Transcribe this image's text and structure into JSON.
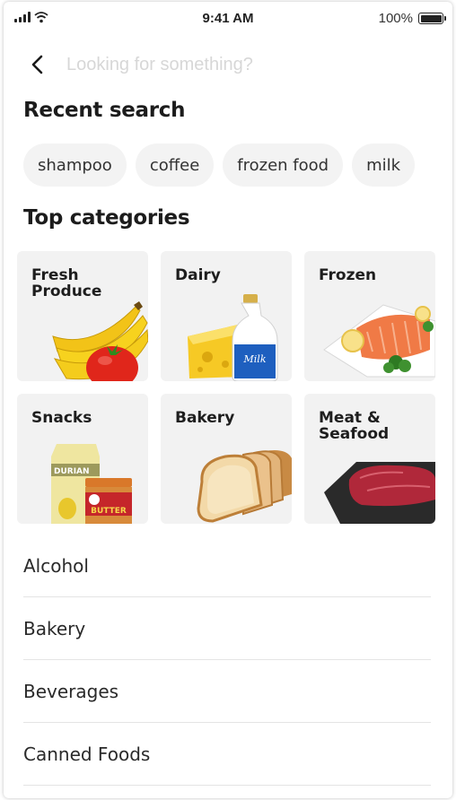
{
  "status_bar": {
    "time": "9:41 AM",
    "battery": "100%",
    "battery_level": 1.0
  },
  "search": {
    "placeholder": "Looking for something?",
    "value": ""
  },
  "recent": {
    "title": "Recent search",
    "items": [
      "shampoo",
      "coffee",
      "frozen food",
      "milk"
    ]
  },
  "categories": {
    "title": "Top categories",
    "cards": [
      {
        "label": "Fresh Produce",
        "image": "banana-tomato-image"
      },
      {
        "label": "Dairy",
        "image": "cheese-milk-image"
      },
      {
        "label": "Frozen",
        "image": "salmon-plate-image"
      },
      {
        "label": "Snacks",
        "image": "snack-jars-image"
      },
      {
        "label": "Bakery",
        "image": "bread-slices-image"
      },
      {
        "label": "Meat & Seafood",
        "image": "steak-board-image"
      }
    ],
    "image_text": {
      "milk": "Milk",
      "butter": "BUTTER",
      "durian": "DURIAN"
    }
  },
  "list": {
    "items": [
      "Alcohol",
      "Bakery",
      "Beverages",
      "Canned Foods"
    ]
  },
  "icons": {
    "back": "chevron-left-icon",
    "signal": "signal-icon",
    "wifi": "wifi-icon",
    "battery": "battery-icon"
  }
}
